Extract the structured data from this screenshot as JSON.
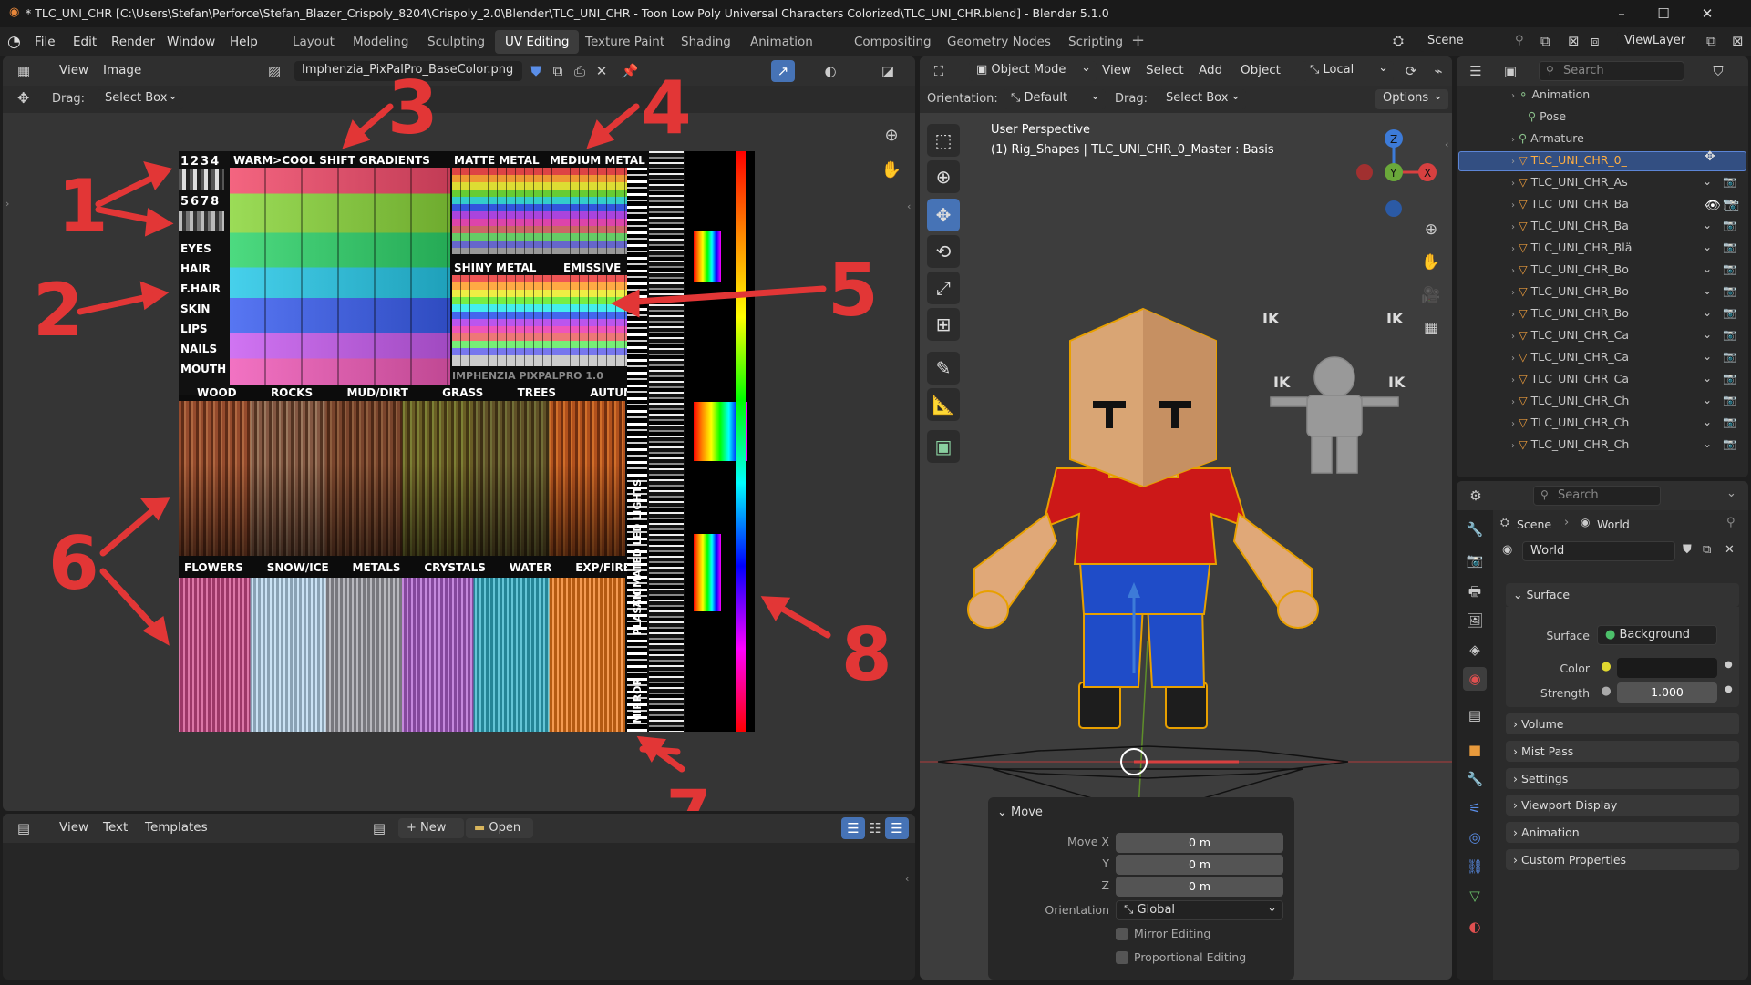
{
  "window": {
    "title": "* TLC_UNI_CHR [C:\\Users\\Stefan\\Perforce\\Stefan_Blazer_Crispoly_8204\\Crispoly_2.0\\Blender\\TLC_UNI_CHR - Toon Low Poly Universal Characters Colorized\\TLC_UNI_CHR.blend] - Blender 5.1.0"
  },
  "menu": [
    "File",
    "Edit",
    "Render",
    "Window",
    "Help"
  ],
  "workspaces": [
    "Layout",
    "Modeling",
    "Sculpting",
    "UV Editing",
    "Texture Paint",
    "Shading",
    "Animation",
    "Compositing",
    "Geometry Nodes",
    "Scripting"
  ],
  "active_workspace": "UV Editing",
  "scene": {
    "name": "Scene",
    "view_layer": "ViewLayer"
  },
  "image_editor": {
    "view": "View",
    "image": "Image",
    "drag_label": "Drag:",
    "drag_value": "Select Box",
    "image_name": "Imphenzia_PixPalPro_BaseColor.png",
    "texture_labels": {
      "nums_top": "1234",
      "nums_mid": "5678",
      "warm_cool": "WARM>COOL SHIFT GRADIENTS",
      "matte_metal": "MATTE METAL",
      "medium_metal": "MEDIUM METAL",
      "eyes": "EYES",
      "hair": "HAIR",
      "fhair": "F.HAIR",
      "skin": "SKIN",
      "lips": "LIPS",
      "nails": "NAILS",
      "mouth": "MOUTH",
      "shiny_metal": "SHINY METAL",
      "emissive": "EMISSIVE",
      "brand": "IMPHENZIA PIXPALPRO 1.0",
      "row1": [
        "WOOD",
        "ROCKS",
        "MUD/DIRT",
        "GRASS",
        "TREES",
        "AUTUMN"
      ],
      "row2": [
        "FLOWERS",
        "SNOW/ICE",
        "METALS",
        "CRYSTALS",
        "WATER",
        "EXP/FIRE"
      ],
      "animated": "ANIMATED LED LIGHTS",
      "plastic": "PLASTIC",
      "mirror": "MIRROR"
    },
    "annotations": [
      "1",
      "2",
      "3",
      "4",
      "5",
      "6",
      "7",
      "8"
    ]
  },
  "text_editor": {
    "view": "View",
    "text": "Text",
    "templates": "Templates",
    "new": "New",
    "open": "Open"
  },
  "viewport": {
    "mode": "Object Mode",
    "view": "View",
    "select": "Select",
    "add": "Add",
    "object": "Object",
    "transform": "Local",
    "orientation_label": "Orientation:",
    "orientation": "Default",
    "drag_label": "Drag:",
    "drag_value": "Select Box",
    "options": "Options",
    "info_line1": "User Perspective",
    "info_line2": "(1) Rig_Shapes | TLC_UNI_CHR_0_Master : Basis",
    "ik": "IK",
    "move_panel": {
      "title": "Move",
      "move_x_label": "Move X",
      "y_label": "Y",
      "z_label": "Z",
      "x": "0 m",
      "y": "0 m",
      "z": "0 m",
      "orientation_label": "Orientation",
      "orientation": "Global",
      "mirror": "Mirror Editing",
      "proportional": "Proportional Editing"
    }
  },
  "outliner": {
    "search_placeholder": "Search",
    "items": [
      "Animation",
      "Pose",
      "Armature",
      "TLC_UNI_CHR_0_",
      "TLC_UNI_CHR_As",
      "TLC_UNI_CHR_Ba",
      "TLC_UNI_CHR_Ba",
      "TLC_UNI_CHR_Blä",
      "TLC_UNI_CHR_Bo",
      "TLC_UNI_CHR_Bo",
      "TLC_UNI_CHR_Bo",
      "TLC_UNI_CHR_Ca",
      "TLC_UNI_CHR_Ca",
      "TLC_UNI_CHR_Ca",
      "TLC_UNI_CHR_Ch",
      "TLC_UNI_CHR_Ch",
      "TLC_UNI_CHR_Ch"
    ]
  },
  "properties": {
    "search_placeholder": "Search",
    "breadcrumb_scene": "Scene",
    "breadcrumb_world": "World",
    "world_name": "World",
    "surface_panel": "Surface",
    "surface_label": "Surface",
    "surface_value": "Background",
    "color_label": "Color",
    "strength_label": "Strength",
    "strength_value": "1.000",
    "panels": [
      "Volume",
      "Mist Pass",
      "Settings",
      "Viewport Display",
      "Animation",
      "Custom Properties"
    ],
    "color_swatch": "#1a1a1a"
  }
}
